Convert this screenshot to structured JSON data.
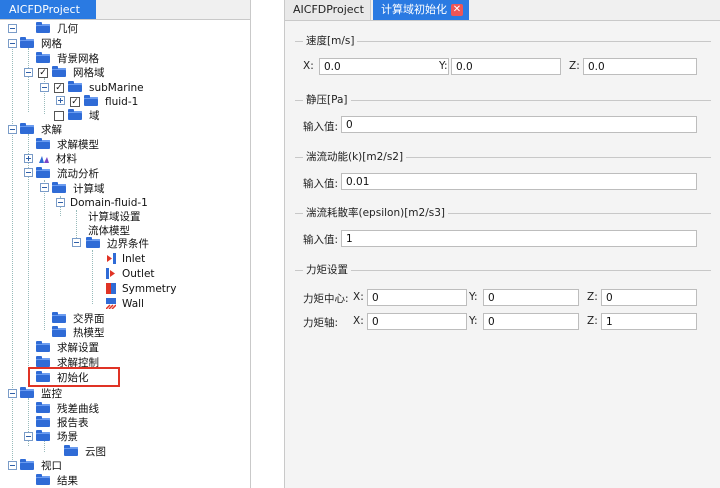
{
  "left_panel": {
    "tab_label": "AICFDProject",
    "tree": {
      "geometry": "几何",
      "mesh": "网格",
      "bg_mesh": "背景网格",
      "mesh_domain": "网格域",
      "submarine": "subMarine",
      "fluid1": "fluid-1",
      "domain": "域",
      "solve": "求解",
      "solve_model": "求解模型",
      "material": "材料",
      "flow_analysis": "流动分析",
      "compute_domain": "计算域",
      "domain_fluid1": "Domain-fluid-1",
      "compute_settings": "计算域设置",
      "fluid_model": "流体模型",
      "boundary": "边界条件",
      "inlet": "Inlet",
      "outlet": "Outlet",
      "symmetry": "Symmetry",
      "wall": "Wall",
      "interface": "交界面",
      "thermal": "热模型",
      "solve_settings": "求解设置",
      "solve_control": "求解控制",
      "init": "初始化",
      "monitor": "监控",
      "residual": "残差曲线",
      "report": "报告表",
      "scene": "场景",
      "contour": "云图",
      "viewport": "视口",
      "result": "结果"
    }
  },
  "right_panel": {
    "tab1_label": "AICFDProject",
    "tab2_label": "计算域初始化",
    "close_glyph": "✕",
    "velocity": {
      "title": "速度[m/s]",
      "x_label": "X:",
      "x_value": "0.0",
      "y_label": "Y:",
      "y_value": "0.0",
      "z_label": "Z:",
      "z_value": "0.0"
    },
    "pressure": {
      "title": "静压[Pa]",
      "input_label": "输入值:",
      "value": "0"
    },
    "tke": {
      "title": "湍流动能(k)[m2/s2]",
      "input_label": "输入值:",
      "value": "0.01"
    },
    "epsilon": {
      "title": "湍流耗散率(epsilon)[m2/s3]",
      "input_label": "输入值:",
      "value": "1"
    },
    "torque": {
      "title": "力矩设置",
      "center_label": "力矩中心:",
      "axis_label": "力矩轴:",
      "x_label": "X:",
      "y_label": "Y:",
      "z_label": "Z:",
      "center_x": "0",
      "center_y": "0",
      "center_z": "0",
      "axis_x": "0",
      "axis_y": "0",
      "axis_z": "1"
    }
  },
  "colors": {
    "accent": "#2a7ae2",
    "highlight": "#e03325",
    "folder": "#2f6bd6"
  }
}
